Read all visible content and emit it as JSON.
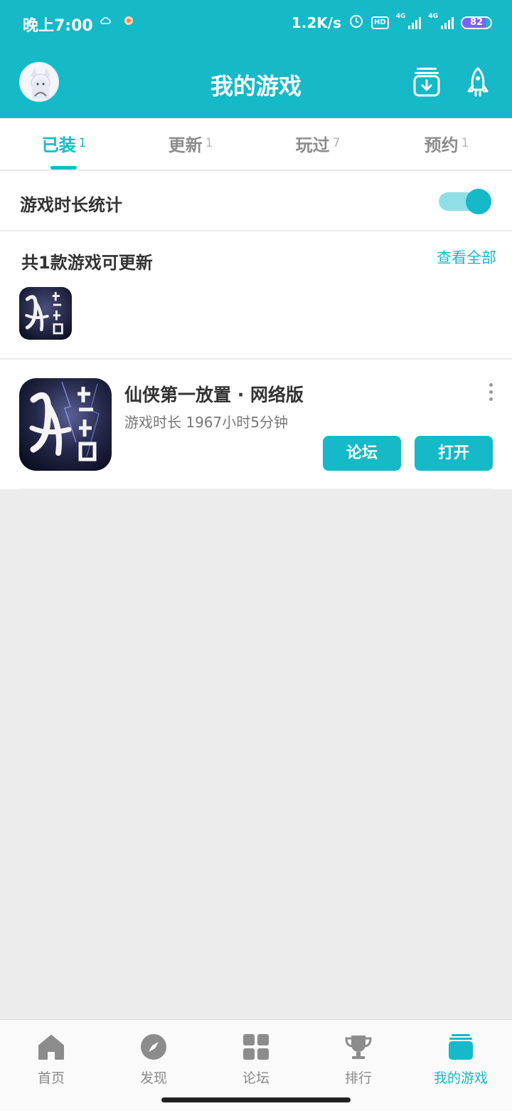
{
  "status_bar": {
    "time": "晚上7:00",
    "speed": "1.2K/s",
    "hd": "HD",
    "net1": "4G",
    "net2": "4G",
    "battery": "82",
    "battery_level": 82
  },
  "header": {
    "title": "我的游戏"
  },
  "tabs": [
    {
      "label": "已装",
      "count": "1"
    },
    {
      "label": "更新",
      "count": "1"
    },
    {
      "label": "玩过",
      "count": "7"
    },
    {
      "label": "预约",
      "count": "1"
    }
  ],
  "stats_row": {
    "label": "游戏时长统计",
    "enabled": true
  },
  "updates": {
    "label": "共1款游戏可更新",
    "view_all": "查看全部"
  },
  "game": {
    "name": "仙侠第一放置 · 网络版",
    "playtime": "游戏时长 1967小时5分钟",
    "forum_button": "论坛",
    "open_button": "打开"
  },
  "bottom_nav": [
    {
      "label": "首页",
      "icon": "home-icon"
    },
    {
      "label": "发现",
      "icon": "compass-icon"
    },
    {
      "label": "论坛",
      "icon": "grid-icon"
    },
    {
      "label": "排行",
      "icon": "trophy-icon"
    },
    {
      "label": "我的游戏",
      "icon": "my-games-icon"
    }
  ],
  "colors": {
    "accent": "#15b9c8",
    "accent_light": "#8fdfe6",
    "background": "#ececec"
  }
}
